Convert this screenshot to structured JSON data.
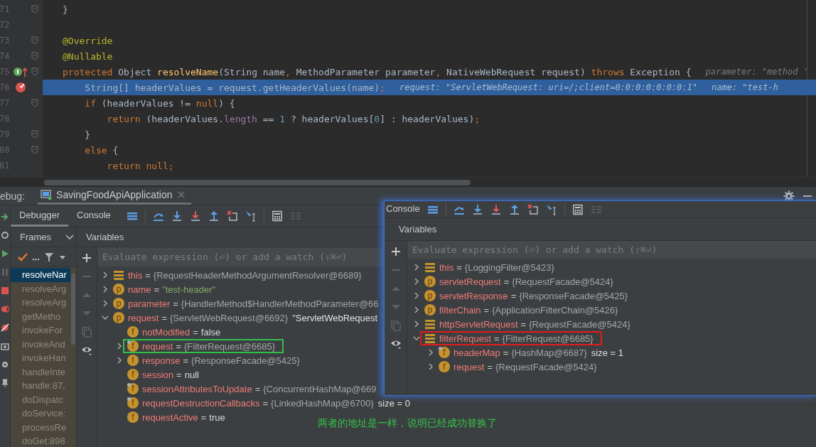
{
  "editor": {
    "lines": [
      {
        "number": "71",
        "fold": true,
        "selected": false,
        "tokens": [
          {
            "text": "}",
            "kind": "plain"
          }
        ]
      },
      {
        "number": "72",
        "fold": false,
        "selected": false
      },
      {
        "number": "73",
        "fold": true,
        "selected": false,
        "tokens": [
          {
            "text": "@Override",
            "kind": "annotation"
          }
        ]
      },
      {
        "number": "74",
        "fold": true,
        "selected": false,
        "tokens": [
          {
            "text": "@Nullable",
            "kind": "annotation"
          }
        ]
      },
      {
        "number": "75",
        "fold": true,
        "selected": false,
        "marker": {
          "kind": "override"
        },
        "tokens": [
          {
            "text": "protected",
            "kind": "keyword"
          },
          {
            "text": " Object ",
            "kind": "plain"
          },
          {
            "text": "resolveName",
            "kind": "decl"
          },
          {
            "text": "(String name",
            "kind": "plain"
          },
          {
            "text": ",",
            "kind": "keyword"
          },
          {
            "text": " MethodParameter parameter",
            "kind": "plain"
          },
          {
            "text": ",",
            "kind": "keyword"
          },
          {
            "text": " NativeWebRequest request) ",
            "kind": "plain"
          },
          {
            "text": "throws",
            "kind": "keyword"
          },
          {
            "text": " Exception {",
            "kind": "plain"
          }
        ],
        "hints": [
          "parameter: \"method '"
        ]
      },
      {
        "number": "76",
        "fold": false,
        "selected": true,
        "marker": {
          "kind": "breakpoint"
        },
        "tokens": [
          {
            "text": "    String[] headerValues = request.getHeaderValues(name)",
            "kind": "plain"
          },
          {
            "text": ";",
            "kind": "keyword"
          }
        ],
        "hints": [
          "request: \"ServletWebRequest: uri=/;client=0:0:0:0:0:0:0:1\"",
          "name: \"test-h"
        ]
      },
      {
        "number": "77",
        "fold": true,
        "selected": false,
        "tokens": [
          {
            "text": "    if",
            "kind": "keyword"
          },
          {
            "text": " (headerValues != ",
            "kind": "plain"
          },
          {
            "text": "null",
            "kind": "keyword"
          },
          {
            "text": ") {",
            "kind": "plain"
          }
        ]
      },
      {
        "number": "78",
        "fold": false,
        "selected": false,
        "tokens": [
          {
            "text": "        return",
            "kind": "keyword"
          },
          {
            "text": " (headerValues.",
            "kind": "plain"
          },
          {
            "text": "length",
            "kind": "field"
          },
          {
            "text": " == ",
            "kind": "plain"
          },
          {
            "text": "1",
            "kind": "number"
          },
          {
            "text": " ? headerValues[",
            "kind": "plain"
          },
          {
            "text": "0",
            "kind": "number"
          },
          {
            "text": "] : headerValues)",
            "kind": "plain"
          },
          {
            "text": ";",
            "kind": "keyword"
          }
        ]
      },
      {
        "number": "79",
        "fold": true,
        "selected": false,
        "tokens": [
          {
            "text": "    }",
            "kind": "plain"
          }
        ]
      },
      {
        "number": "80",
        "fold": true,
        "selected": false,
        "tokens": [
          {
            "text": "    else",
            "kind": "keyword"
          },
          {
            "text": " {",
            "kind": "plain"
          }
        ]
      },
      {
        "number": "81",
        "fold": false,
        "selected": false,
        "tokens": [
          {
            "text": "        return null;",
            "kind": "keyword"
          }
        ]
      }
    ]
  },
  "debug": {
    "label": "ebug:",
    "session": "SavingFoodApiApplication",
    "tabs": [
      {
        "label": "Debugger",
        "selected": true
      },
      {
        "label": "Console",
        "selected": false
      }
    ],
    "frames": {
      "title": "Frames",
      "more": "...",
      "items": [
        {
          "label": "resolveNar",
          "selected": true
        },
        {
          "label": "resolveArg",
          "selected": false
        },
        {
          "label": "resolveArg",
          "selected": false
        },
        {
          "label": "getMetho",
          "selected": false
        },
        {
          "label": "invokeFor",
          "selected": false
        },
        {
          "label": "invokeAnd",
          "selected": false
        },
        {
          "label": "invokeHan",
          "selected": false
        },
        {
          "label": "handleInte",
          "selected": false
        },
        {
          "label": "handle:87,",
          "selected": false
        },
        {
          "label": "doDispatc",
          "selected": false
        },
        {
          "label": "doService:",
          "selected": false
        },
        {
          "label": "processRe",
          "selected": false
        },
        {
          "label": "doGet:898",
          "selected": false
        }
      ]
    },
    "variables": {
      "title": "Variables",
      "placeholder": "Evaluate expression (⏎) or add a watch (⇧⌘⏎)",
      "items": [
        {
          "kind": "object",
          "name": "this",
          "eq": "=",
          "value": "{RequestHeaderMethodArgumentResolver@6689}",
          "color": "#a4a4a4",
          "expanded": false,
          "boxed": false
        },
        {
          "kind": "param",
          "badge": "p",
          "name": "name",
          "eq": "=",
          "value": "\"test-header\"",
          "color": "#7fa866",
          "expanded": false,
          "boxed": false
        },
        {
          "kind": "param",
          "badge": "p",
          "name": "parameter",
          "eq": "=",
          "value": "{HandlerMethod$HandlerMethodParameter@66",
          "color": "#a4a4a4",
          "expanded": false,
          "boxed": false
        },
        {
          "kind": "param",
          "badge": "p",
          "name": "request",
          "eq": "=",
          "value": "{ServletWebRequest@6692}",
          "color": "#a4a4a4",
          "extra": "\"ServletWebRequest",
          "expanded": true,
          "boxed": false,
          "children": [
            {
              "kind": "field",
              "badge": "f",
              "marked": false,
              "name": "notModified",
              "eq": "=",
              "value": "false",
              "color": "#d8d8d8",
              "boxed": false
            },
            {
              "kind": "field",
              "badge": "f",
              "marked": true,
              "name": "request",
              "eq": "=",
              "value": "{FilterRequest@6685}",
              "expanded": false,
              "boxed": true
            },
            {
              "kind": "field",
              "badge": "f",
              "marked": false,
              "name": "response",
              "eq": "=",
              "value": "{ResponseFacade@5425}",
              "color": "#a4a4a4",
              "expanded": false,
              "boxed": false
            },
            {
              "kind": "field",
              "badge": "f",
              "marked": false,
              "name": "session",
              "eq": "=",
              "value": "null",
              "color": "#d8d8d8",
              "boxed": false
            },
            {
              "kind": "field",
              "badge": "f",
              "marked": true,
              "name": "sessionAttributesToUpdate",
              "eq": "=",
              "value": "{ConcurrentHashMap@669",
              "color": "#a4a4a4",
              "boxed": false
            },
            {
              "kind": "field",
              "badge": "f",
              "marked": true,
              "name": "requestDestructionCallbacks",
              "eq": "=",
              "value": "{LinkedHashMap@6700}",
              "color": "#a4a4a4",
              "extra": "size = 0",
              "boxed": false
            },
            {
              "kind": "field",
              "badge": "f",
              "marked": false,
              "name": "requestActive",
              "eq": "=",
              "value": "true",
              "color": "#d8d8d8",
              "boxed": false
            }
          ]
        }
      ]
    }
  },
  "overlay": {
    "tabs": [
      {
        "label": "Console",
        "selected": false
      }
    ],
    "variables": {
      "title": "Variables",
      "placeholder": "Evaluate expression (⏎) or add a watch (⇧⌘⏎)",
      "items": [
        {
          "kind": "object",
          "name": "this",
          "eq": "=",
          "value": "{LoggingFilter@5423}",
          "color": "#a4a4a4",
          "expanded": false,
          "boxed": false
        },
        {
          "kind": "param",
          "badge": "p",
          "name": "servletRequest",
          "eq": "=",
          "value": "{RequestFacade@5424}",
          "color": "#a4a4a4",
          "expanded": false,
          "boxed": false
        },
        {
          "kind": "param",
          "badge": "p",
          "name": "servletResponse",
          "eq": "=",
          "value": "{ResponseFacade@5425}",
          "color": "#a4a4a4",
          "expanded": false,
          "boxed": false
        },
        {
          "kind": "param",
          "badge": "p",
          "name": "filterChain",
          "eq": "=",
          "value": "{ApplicationFilterChain@5426}",
          "color": "#a4a4a4",
          "expanded": false,
          "boxed": false
        },
        {
          "kind": "object",
          "name": "httpServletRequest",
          "eq": "=",
          "value": "{RequestFacade@5424}",
          "color": "#a4a4a4",
          "expanded": false,
          "boxed": false
        },
        {
          "kind": "object",
          "name": "filterRequest",
          "eq": "=",
          "value": "{FilterRequest@6685}",
          "expanded": true,
          "boxed": true,
          "children": [
            {
              "kind": "field",
              "badge": "f",
              "marked": true,
              "name": "headerMap",
              "eq": "=",
              "value": "{HashMap@6687}",
              "color": "#a4a4a4",
              "extra": "size = 1",
              "expanded": false,
              "boxed": false
            },
            {
              "kind": "field",
              "badge": "f",
              "marked": false,
              "name": "request",
              "eq": "=",
              "value": "{RequestFacade@5424}",
              "color": "#a4a4a4",
              "expanded": false,
              "boxed": false
            }
          ]
        }
      ]
    }
  },
  "note": "两者的地址是一样，说明已经成功替换了"
}
